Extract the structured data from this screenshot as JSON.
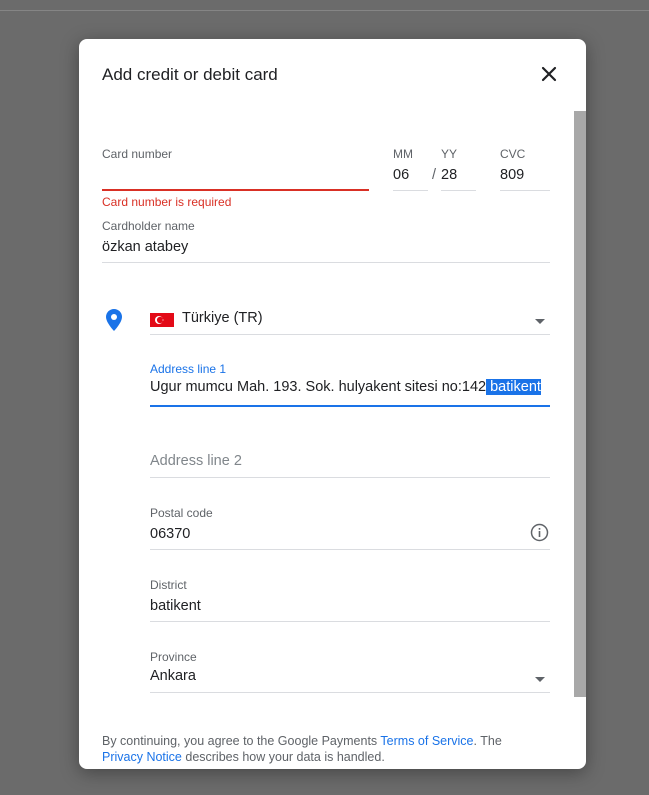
{
  "dialog": {
    "title": "Add credit or debit card",
    "close_icon": "close-icon"
  },
  "card": {
    "number_label": "Card number",
    "number_value": "",
    "number_error": "Card number is required",
    "mm_label": "MM",
    "mm_value": "06",
    "yy_separator": "/",
    "yy_label": "YY",
    "yy_value": "28",
    "cvc_label": "CVC",
    "cvc_value": "809",
    "holder_label": "Cardholder name",
    "holder_value": "özkan atabey"
  },
  "address": {
    "location_icon": "location-pin-icon",
    "country_flag_icon": "turkey-flag-icon",
    "country_value": "Türkiye (TR)",
    "line1_label": "Address line 1",
    "line1_value_plain": "Ugur mumcu Mah. 193. Sok. hulyakent sitesi no:142",
    "line1_value_selected": " batikent",
    "line2_placeholder": "Address line 2",
    "postal_label": "Postal code",
    "postal_value": "06370",
    "postal_info_icon": "info-icon",
    "district_label": "District",
    "district_value": "batikent",
    "province_label": "Province",
    "province_value": "Ankara"
  },
  "footer": {
    "text_1": "By continuing, you agree to the Google Payments ",
    "terms_link": "Terms of Service",
    "text_2": ". The ",
    "privacy_link": "Privacy Notice",
    "text_3": " describes how your data is handled."
  },
  "colors": {
    "accent": "#1a73e8",
    "error": "#d93025",
    "overlay": "#6b6b6b"
  }
}
